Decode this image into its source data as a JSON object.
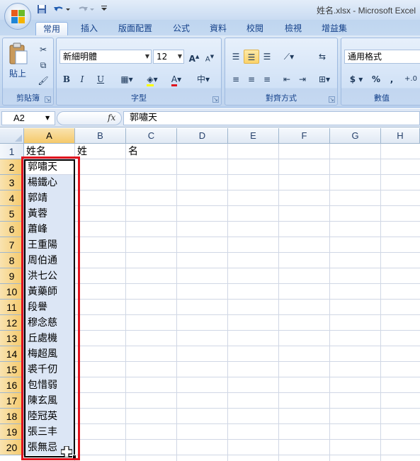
{
  "window": {
    "title": "姓名.xlsx - Microsoft Excel"
  },
  "quick_access": {
    "save_icon": "save-icon",
    "undo_icon": "undo-icon",
    "redo_icon": "redo-icon",
    "customize_icon": "customize-icon"
  },
  "tabs": [
    "常用",
    "插入",
    "版面配置",
    "公式",
    "資料",
    "校閱",
    "檢視",
    "增益集"
  ],
  "ribbon": {
    "clipboard": {
      "label": "剪貼簿",
      "paste_label": "貼上"
    },
    "font": {
      "label": "字型",
      "font_name": "新細明體",
      "font_size": "12",
      "bold": "B",
      "italic": "I",
      "underline": "U",
      "grow": "A",
      "shrink": "A"
    },
    "alignment": {
      "label": "對齊方式"
    },
    "number": {
      "label": "數值",
      "format": "通用格式",
      "currency": "$",
      "percent": "%",
      "comma": ",",
      "increase_decimal": "+.0"
    }
  },
  "formula_bar": {
    "name_box": "A2",
    "fx": "fx",
    "formula": "郭嘯天"
  },
  "sheet": {
    "columns": [
      "A",
      "B",
      "C",
      "D",
      "E",
      "F",
      "G",
      "H"
    ],
    "rows": [
      "1",
      "2",
      "3",
      "4",
      "5",
      "6",
      "7",
      "8",
      "9",
      "10",
      "11",
      "12",
      "13",
      "14",
      "15",
      "16",
      "17",
      "18",
      "19",
      "20"
    ],
    "header_row": {
      "A": "姓名",
      "B": "姓",
      "C": "名"
    },
    "names": [
      "郭嘯天",
      "楊鐵心",
      "郭靖",
      "黃蓉",
      "蕭峰",
      "王重陽",
      "周伯通",
      "洪七公",
      "黃藥師",
      "段譽",
      "穆念慈",
      "丘處機",
      "梅超風",
      "裘千仞",
      "包惜弱",
      "陳玄風",
      "陸冠英",
      "張三丰",
      "張無忌"
    ],
    "selected_column": "A",
    "selected_rows": "2-20"
  },
  "colors": {
    "highlight_border": "#e0141e",
    "header_selected": "#f5c96a",
    "selection_fill": "#dce6f5"
  }
}
